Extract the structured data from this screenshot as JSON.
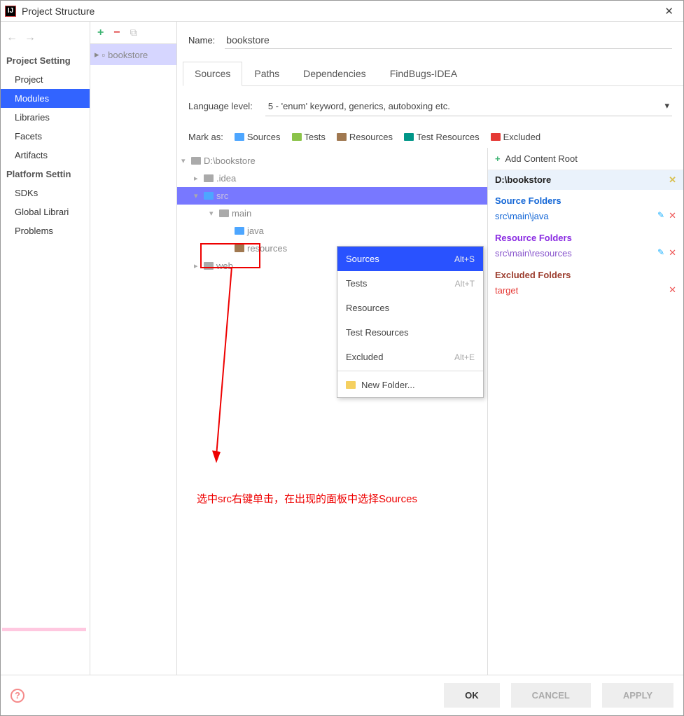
{
  "title": "Project Structure",
  "sidebar": {
    "sections": [
      {
        "header": "Project Setting",
        "items": [
          "Project",
          "Modules",
          "Libraries",
          "Facets",
          "Artifacts"
        ],
        "selected": "Modules"
      },
      {
        "header": "Platform Settin",
        "items": [
          "SDKs",
          "Global Librari"
        ]
      },
      {
        "header": "",
        "items": [
          "Problems"
        ]
      }
    ]
  },
  "module": {
    "name": "bookstore"
  },
  "content": {
    "name_label": "Name:",
    "name_value": "bookstore",
    "tabs": [
      "Sources",
      "Paths",
      "Dependencies",
      "FindBugs-IDEA"
    ],
    "active_tab": "Sources",
    "lang_label": "Language level:",
    "lang_value": "5 - 'enum' keyword, generics, autoboxing etc.",
    "mark_label": "Mark as:",
    "marks": [
      "Sources",
      "Tests",
      "Resources",
      "Test Resources",
      "Excluded"
    ]
  },
  "tree": [
    {
      "l": 0,
      "exp": "▾",
      "icon": "gray",
      "label": "D:\\bookstore"
    },
    {
      "l": 1,
      "exp": "▸",
      "icon": "gray",
      "label": ".idea"
    },
    {
      "l": 1,
      "exp": "▾",
      "icon": "blue",
      "label": "src",
      "sel": true
    },
    {
      "l": 2,
      "exp": "▾",
      "icon": "gray",
      "label": "main"
    },
    {
      "l": 3,
      "exp": "",
      "icon": "blue",
      "label": "java"
    },
    {
      "l": 3,
      "exp": "",
      "icon": "brown",
      "label": "resources"
    },
    {
      "l": 1,
      "exp": "▸",
      "icon": "gray",
      "label": "web"
    }
  ],
  "context_menu": {
    "items": [
      {
        "label": "Sources",
        "hint": "Alt+S",
        "hl": true
      },
      {
        "label": "Tests",
        "hint": "Alt+T"
      },
      {
        "label": "Resources",
        "hint": ""
      },
      {
        "label": "Test Resources",
        "hint": ""
      },
      {
        "label": "Excluded",
        "hint": "Alt+E"
      }
    ],
    "divider": true,
    "newfolder": "New Folder..."
  },
  "rightpane": {
    "add": "Add Content Root",
    "root": "D:\\bookstore",
    "groups": [
      {
        "title": "Source Folders",
        "cls": "c-blue",
        "items": [
          {
            "path": "src\\main\\java",
            "edit": true
          }
        ]
      },
      {
        "title": "Resource Folders",
        "cls": "c-purple",
        "items": [
          {
            "path": "src\\main\\resources",
            "pcls": "c-purple2",
            "edit": true
          }
        ]
      },
      {
        "title": "Excluded Folders",
        "cls": "c-brown",
        "items": [
          {
            "path": "target",
            "pcls": "c-red",
            "edit": false
          }
        ]
      }
    ]
  },
  "annotation": "选中src右键单击，在出现的面板中选择Sources",
  "footer": {
    "ok": "OK",
    "cancel": "CANCEL",
    "apply": "APPLY"
  }
}
